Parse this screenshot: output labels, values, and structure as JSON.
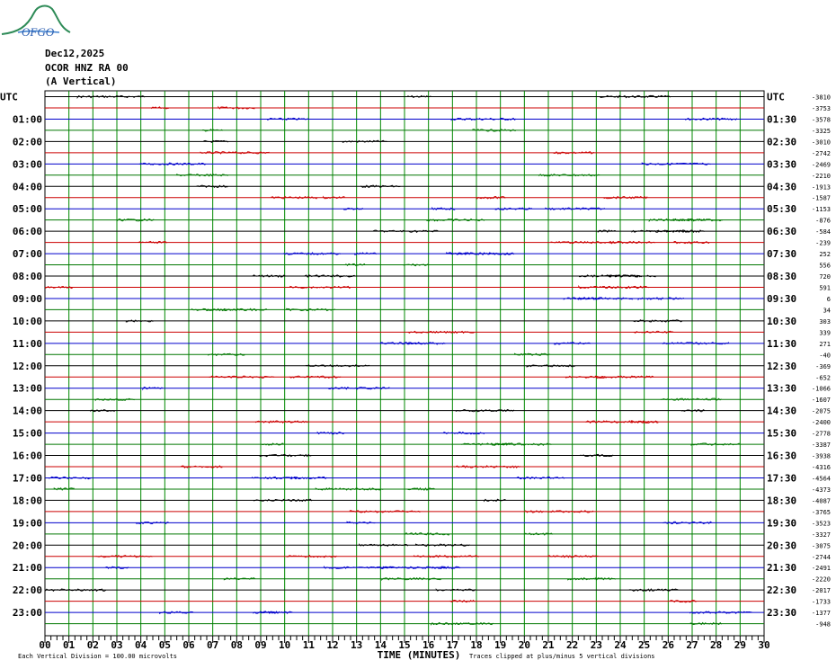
{
  "logo_text": "OFGO",
  "header": {
    "date": "Dec12,2025",
    "station": "OCOR HNZ RA 00",
    "component": "(A Vertical)"
  },
  "left_axis_title": "UTC",
  "right_axis_title": "UTC",
  "footer": {
    "xlabel": "TIME (MINUTES)",
    "scale_note": "Each Vertical Division =  100.00 microvolts",
    "clip_note": "Traces clipped at plus/minus 5 vertical divisions"
  },
  "colors": {
    "cycle": [
      "#000000",
      "#cc0000",
      "#0000cc",
      "#007700"
    ],
    "grid": "#008800"
  },
  "chart_data": {
    "type": "line",
    "title": "",
    "xlabel": "TIME (MINUTES)",
    "ylabel": "UTC",
    "xlim": [
      0,
      30
    ],
    "x_ticks": [
      "00",
      "01",
      "02",
      "03",
      "04",
      "05",
      "06",
      "07",
      "08",
      "09",
      "10",
      "11",
      "12",
      "13",
      "14",
      "15",
      "16",
      "17",
      "18",
      "19",
      "20",
      "21",
      "22",
      "23",
      "24",
      "25",
      "26",
      "27",
      "28",
      "29",
      "30"
    ],
    "left_hour_labels": [
      "UTC",
      "01:00",
      "02:00",
      "03:00",
      "04:00",
      "05:00",
      "06:00",
      "07:00",
      "08:00",
      "09:00",
      "10:00",
      "11:00",
      "12:00",
      "13:00",
      "14:00",
      "15:00",
      "16:00",
      "17:00",
      "18:00",
      "19:00",
      "20:00",
      "21:00",
      "22:00",
      "23:00"
    ],
    "right_half_labels": [
      "UTC",
      "01:30",
      "02:30",
      "03:30",
      "04:30",
      "05:30",
      "06:30",
      "07:30",
      "08:30",
      "09:30",
      "10:30",
      "11:30",
      "12:30",
      "13:30",
      "14:30",
      "15:30",
      "16:30",
      "17:30",
      "18:30",
      "19:30",
      "20:30",
      "21:30",
      "22:30",
      "23:30"
    ],
    "trace_offsets": [
      "-3810",
      "-3753",
      "-3578",
      "-3325",
      "-3010",
      "-2742",
      "-2469",
      "-2210",
      "-1913",
      "-1587",
      "-1153",
      "-876",
      "-584",
      "-239",
      "252",
      "556",
      "720",
      "591",
      "6",
      "34",
      "303",
      "339",
      "271",
      "-40",
      "-369",
      "-652",
      "-1066",
      "-1607",
      "-2075",
      "-2400",
      "-2778",
      "-3387",
      "-3938",
      "-4316",
      "-4564",
      "-4373",
      "-4087",
      "-3765",
      "-3523",
      "-3327",
      "-3075",
      "-2744",
      "-2491",
      "-2220",
      "-2017",
      "-1733",
      "-1377",
      "-948"
    ],
    "clip_divisions": 5,
    "microvolts_per_division": 100.0,
    "trace_interval_minutes": 30,
    "trace_count": 48
  }
}
